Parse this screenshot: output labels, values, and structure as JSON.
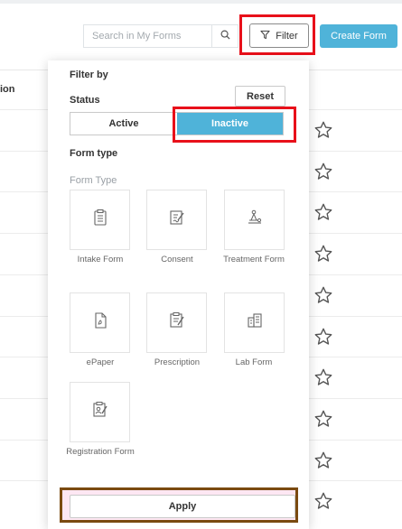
{
  "toolbar": {
    "search_placeholder": "Search in My Forms",
    "filter_label": "Filter",
    "create_label": "Create Form"
  },
  "table": {
    "partial_header": "ion",
    "row_count": 10
  },
  "filter_panel": {
    "title": "Filter by",
    "status_label": "Status",
    "reset_label": "Reset",
    "status_options": [
      "Active",
      "Inactive"
    ],
    "selected_status": "Inactive",
    "form_type_label": "Form type",
    "form_type_sub": "Form Type",
    "form_types": [
      {
        "label": "Intake Form",
        "icon": "clipboard-icon"
      },
      {
        "label": "Consent",
        "icon": "signature-icon"
      },
      {
        "label": "Treatment Form",
        "icon": "treatment-icon"
      },
      {
        "label": "ePaper",
        "icon": "pdf-icon"
      },
      {
        "label": "Prescription",
        "icon": "prescription-icon"
      },
      {
        "label": "Lab Form",
        "icon": "lab-icon"
      },
      {
        "label": "Registration Form",
        "icon": "registration-icon"
      }
    ],
    "apply_label": "Apply"
  },
  "colors": {
    "accent": "#4fb3d9",
    "highlight_red": "#e8101a",
    "highlight_brown": "#7a4a10"
  }
}
